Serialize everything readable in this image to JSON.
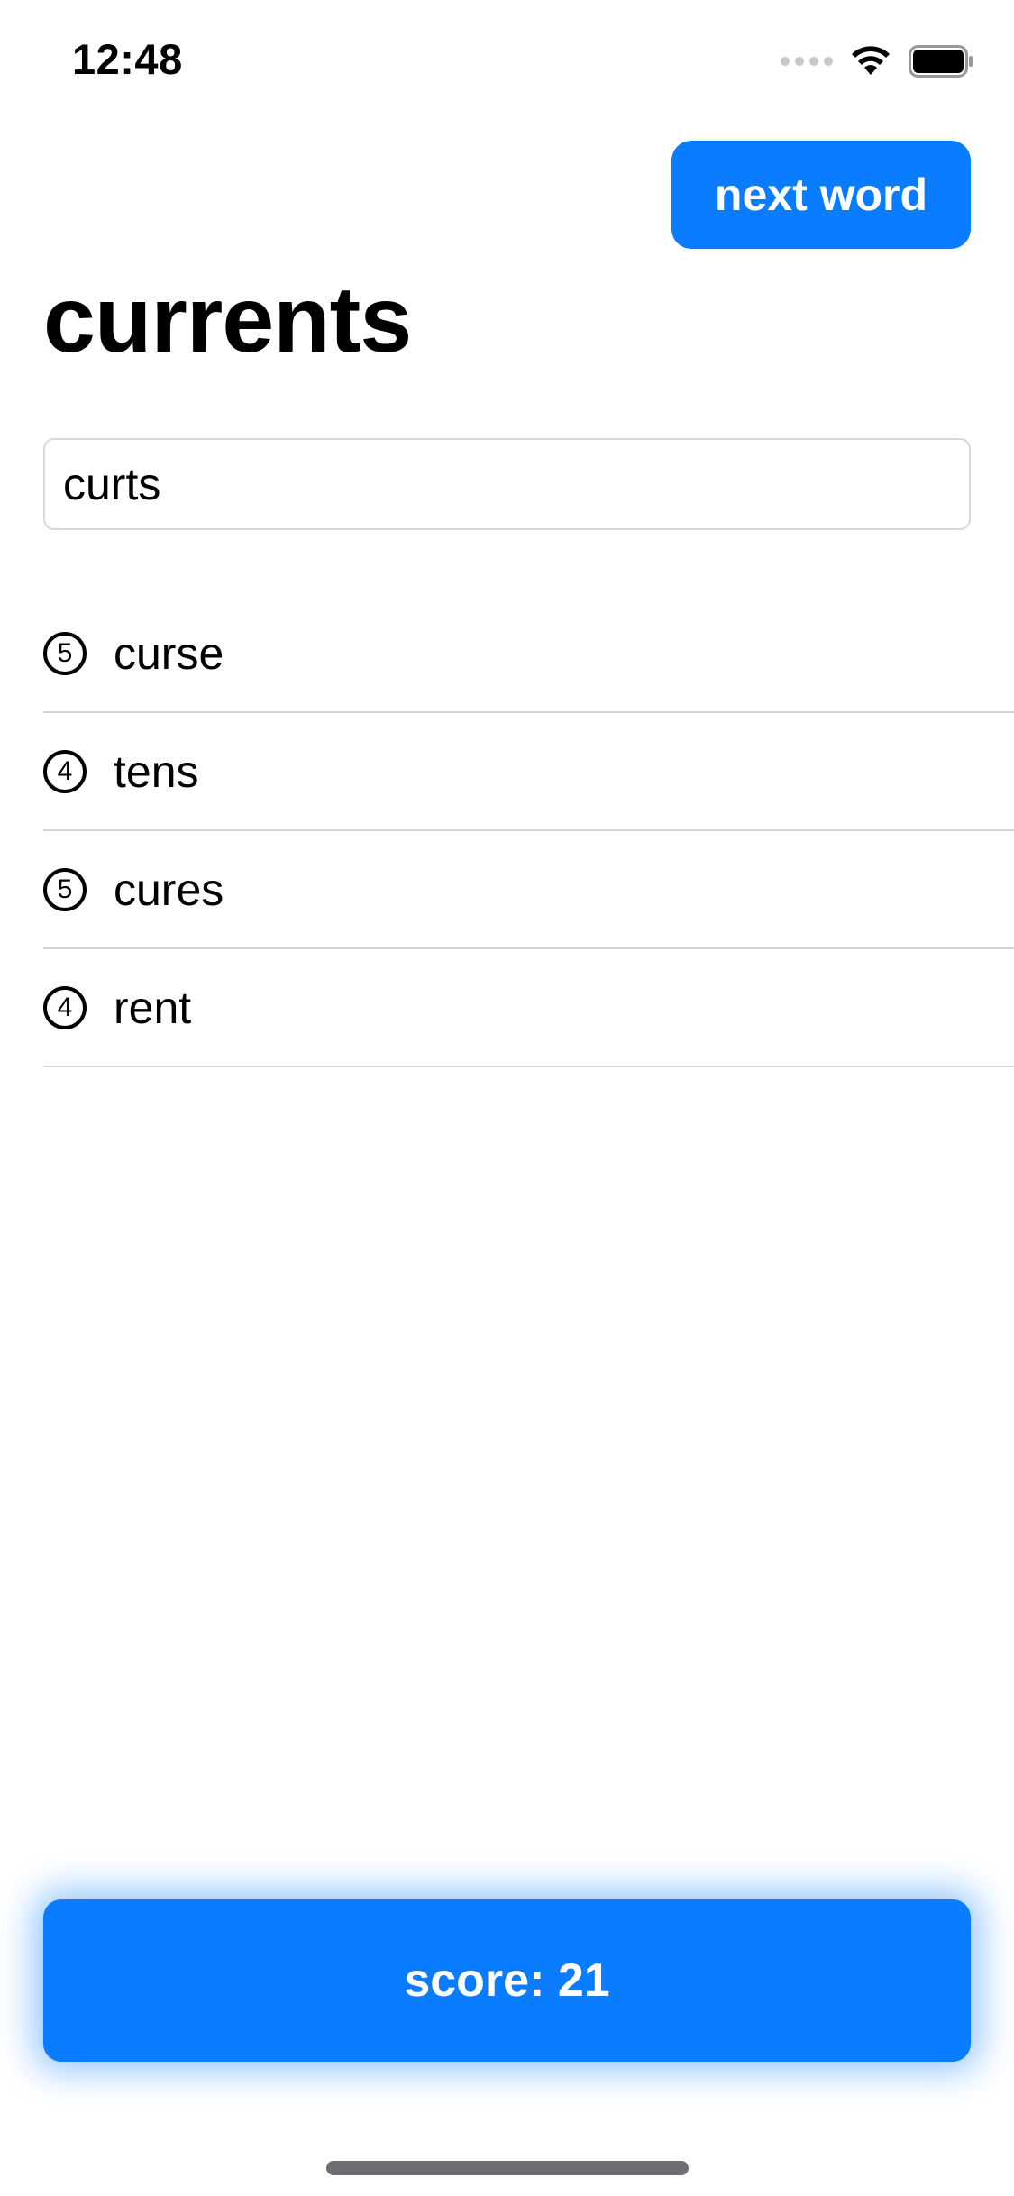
{
  "status_bar": {
    "time": "12:48",
    "icons": [
      "cellular-signal-icon",
      "wifi-icon",
      "battery-icon"
    ]
  },
  "header": {
    "next_button_label": "next word"
  },
  "root_word": "currents",
  "input": {
    "value": "curts",
    "placeholder": ""
  },
  "used_words": [
    {
      "count": "5",
      "word": "curse"
    },
    {
      "count": "4",
      "word": "tens"
    },
    {
      "count": "5",
      "word": "cures"
    },
    {
      "count": "4",
      "word": "rent"
    }
  ],
  "score_button_label": "score: 21",
  "colors": {
    "accent": "#0a7cff",
    "background": "#ffffff",
    "separator": "#d4d4d8"
  }
}
